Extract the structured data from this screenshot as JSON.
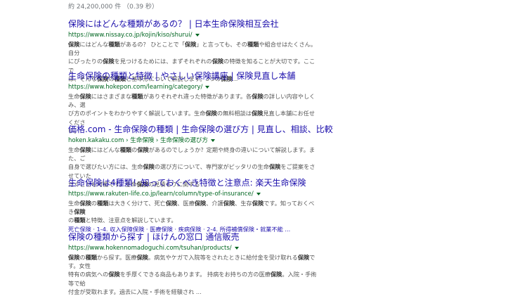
{
  "search_stats": "約 24,200,000 件 （0.39 秒）",
  "results": [
    {
      "title": "保険にはどんな種類があるの？ | 日本生命保険相互会社",
      "url": "https://www.nissay.co.jp/kojin/kiso/shurui/",
      "snippet_lines": [
        [
          [
            "b",
            "保険"
          ],
          [
            "t",
            "にはどんな"
          ],
          [
            "b",
            "種類"
          ],
          [
            "t",
            "があるの？ ひとことで「"
          ],
          [
            "b",
            "保険"
          ],
          [
            "t",
            "」と言っても、その"
          ],
          [
            "b",
            "種類"
          ],
          [
            "t",
            "や組合せはたくさん。自分"
          ]
        ],
        [
          [
            "t",
            "にぴったりの"
          ],
          [
            "b",
            "保険"
          ],
          [
            "t",
            "を見つけるためには、まずそれぞれの"
          ],
          [
            "b",
            "保険"
          ],
          [
            "t",
            "の特徴を知ることが大切です。ここで"
          ]
        ],
        [
          [
            "t",
            "は、そんな"
          ],
          [
            "b",
            "保険"
          ],
          [
            "t",
            "の"
          ],
          [
            "b",
            "種類"
          ],
          [
            "t",
            "と基本形について解説します。3つの"
          ],
          [
            "b",
            "保険"
          ],
          [
            "t",
            "..."
          ]
        ]
      ]
    },
    {
      "title": "生命保険の種類と特徴 | やさしい保険講座 | 保険見直し本舗",
      "url": "https://www.hokepon.com/learning/category/",
      "snippet_lines": [
        [
          [
            "t",
            "生命"
          ],
          [
            "b",
            "保険"
          ],
          [
            "t",
            "にはさまざまな"
          ],
          [
            "b",
            "種類"
          ],
          [
            "t",
            "がありそれぞれ違った特徴があります。各"
          ],
          [
            "b",
            "保険"
          ],
          [
            "t",
            "の詳しい内容やしくみ、選"
          ]
        ],
        [
          [
            "t",
            "び方のポイントをわかりやすく解説しています。生命"
          ],
          [
            "b",
            "保険"
          ],
          [
            "t",
            "の無料相談は"
          ],
          [
            "b",
            "保険"
          ],
          [
            "t",
            "見直し本舗にお任せくださ"
          ]
        ],
        [
          [
            "t",
            "い。"
          ]
        ]
      ]
    },
    {
      "title": "価格.com - 生命保険の種類 | 生命保険の選び方 | 見直し、相談、比較",
      "url": "hoken.kakaku.com › 生命保険 › 生命保険の選び方",
      "snippet_lines": [
        [
          [
            "t",
            "生命"
          ],
          [
            "b",
            "保険"
          ],
          [
            "t",
            "にはどんな"
          ],
          [
            "b",
            "種類"
          ],
          [
            "t",
            "の"
          ],
          [
            "b",
            "保険"
          ],
          [
            "t",
            "があるのでしょうか？定期や終身の違いについて解説します。また、ご"
          ]
        ],
        [
          [
            "t",
            "自身で選びたい方には、生命"
          ],
          [
            "b",
            "保険"
          ],
          [
            "t",
            "の選び方について、専門家がピッタリの生命"
          ],
          [
            "b",
            "保険"
          ],
          [
            "t",
            "をご提案をさせていた"
          ]
        ],
        [
          [
            "t",
            "だくことも可能です。生命"
          ],
          [
            "b",
            "保険"
          ],
          [
            "t",
            "の見積もりに関する ..."
          ]
        ]
      ]
    },
    {
      "title": "生命保険は4種類！知っておくべき特徴と注意点: 楽天生命保険",
      "url": "https://www.rakuten-life.co.jp/learn/column/type-of-insurance/",
      "snippet_lines": [
        [
          [
            "t",
            "生命"
          ],
          [
            "b",
            "保険"
          ],
          [
            "t",
            "の"
          ],
          [
            "b",
            "種類"
          ],
          [
            "t",
            "は大きく分けて、死亡"
          ],
          [
            "b",
            "保険"
          ],
          [
            "t",
            "、医療"
          ],
          [
            "b",
            "保険"
          ],
          [
            "t",
            "、介護"
          ],
          [
            "b",
            "保険"
          ],
          [
            "t",
            "、生存"
          ],
          [
            "b",
            "保険"
          ],
          [
            "t",
            "です。知っておくべき"
          ],
          [
            "b",
            "保険"
          ]
        ],
        [
          [
            "t",
            "の"
          ],
          [
            "b",
            "種類"
          ],
          [
            "t",
            "と特徴、注意点を解説しています。"
          ]
        ]
      ],
      "sitelinks": "死亡保険 · 1-4. 収入保障保険 · 医療保険 · 疾病保険 · 2-4. 所得補償保険・就業不能 ..."
    },
    {
      "title": "保険の種類から探す | ほけんの窓口 通信販売",
      "url": "https://www.hokennomadoguchi.com/tsuhan/products/",
      "snippet_lines": [
        [
          [
            "b",
            "保険"
          ],
          [
            "t",
            "の"
          ],
          [
            "b",
            "種類"
          ],
          [
            "t",
            "から探す。医療"
          ],
          [
            "b",
            "保険"
          ],
          [
            "t",
            "。病気やケガで入院等をされたときに給付金を受け取れる"
          ],
          [
            "b",
            "保険"
          ],
          [
            "t",
            "です。女性"
          ]
        ],
        [
          [
            "t",
            "特有の病気への"
          ],
          [
            "b",
            "保険"
          ],
          [
            "t",
            "を手厚くできる商品もあります。 持病をお持ちの方の医療"
          ],
          [
            "b",
            "保険"
          ],
          [
            "t",
            "。入院・手術等で給"
          ]
        ],
        [
          [
            "t",
            "付金が受取れます。過去に入院・手術を経験され ..."
          ]
        ]
      ]
    }
  ]
}
